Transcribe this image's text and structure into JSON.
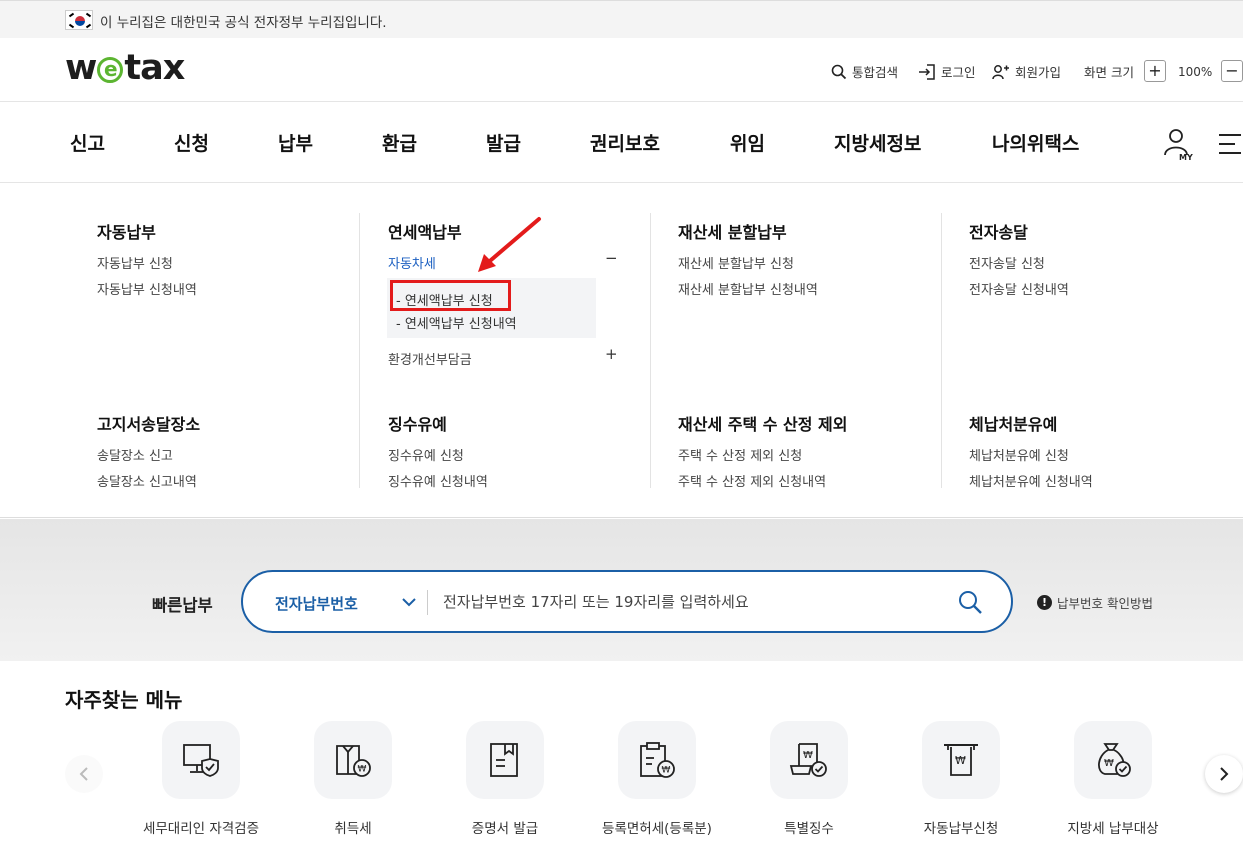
{
  "gov_banner": {
    "flag_icon": "korea-flag-icon",
    "text": "이 누리집은 대한민국 공식 전자정부 누리집입니다."
  },
  "header": {
    "logo": {
      "pre": "w",
      "mid": "e",
      "post": "tax",
      "accent": "#5cb531"
    },
    "utils": {
      "search": "통합검색",
      "login": "로그인",
      "signup": "회원가입",
      "zoom_label": "화면 크기",
      "zoom_in": "+",
      "zoom_value": "100%",
      "zoom_out": "−"
    }
  },
  "gnb": {
    "items": [
      "신고",
      "신청",
      "납부",
      "환급",
      "발급",
      "권리보호",
      "위임",
      "지방세정보",
      "나의위택스"
    ],
    "my_label": "MY"
  },
  "mega": {
    "col1": {
      "title": "자동납부",
      "links": [
        "자동납부 신청",
        "자동납부 신청내역"
      ]
    },
    "col2": {
      "title": "연세액납부",
      "active_link": "자동차세",
      "active_toggle": "−",
      "sub_links": [
        "연세액납부 신청",
        "연세액납부 신청내역"
      ],
      "sub_prefix": "-",
      "link2": "환경개선부담금",
      "link2_toggle": "+"
    },
    "col3": {
      "title": "재산세 분할납부",
      "links": [
        "재산세 분할납부 신청",
        "재산세 분할납부 신청내역"
      ]
    },
    "col4": {
      "title": "전자송달",
      "links": [
        "전자송달 신청",
        "전자송달 신청내역"
      ]
    },
    "col5": {
      "title": "고지서송달장소",
      "links": [
        "송달장소 신고",
        "송달장소 신고내역"
      ]
    },
    "col6": {
      "title": "징수유예",
      "links": [
        "징수유예 신청",
        "징수유예 신청내역"
      ]
    },
    "col7": {
      "title": "재산세 주택 수 산정 제외",
      "links": [
        "주택 수 산정 제외 신청",
        "주택 수 산정 제외 신청내역"
      ]
    },
    "col8": {
      "title": "체납처분유예",
      "links": [
        "체납처분유예 신청",
        "체납처분유예 신청내역"
      ]
    },
    "highlight_color": "#e31b1b"
  },
  "quick_pay": {
    "label": "빠른납부",
    "select_value": "전자납부번호",
    "placeholder": "전자납부번호 17자리 또는 19자리를 입력하세요",
    "help": "납부번호 확인방법",
    "help_icon": "!",
    "accent": "#1b5fa6"
  },
  "frequent": {
    "title": "자주찾는 메뉴",
    "items": [
      {
        "label": "세무대리인 자격검증",
        "icon": "monitor-shield-icon"
      },
      {
        "label": "취득세",
        "icon": "box-coin-icon"
      },
      {
        "label": "증명서 발급",
        "icon": "document-bookmark-icon"
      },
      {
        "label": "등록면허세(등록분)",
        "icon": "clipboard-coin-icon"
      },
      {
        "label": "특별징수",
        "icon": "receipt-check-icon"
      },
      {
        "label": "자동납부신청",
        "icon": "receipt-printer-icon"
      },
      {
        "label": "지방세 납부대상",
        "icon": "money-bag-check-icon"
      }
    ]
  }
}
